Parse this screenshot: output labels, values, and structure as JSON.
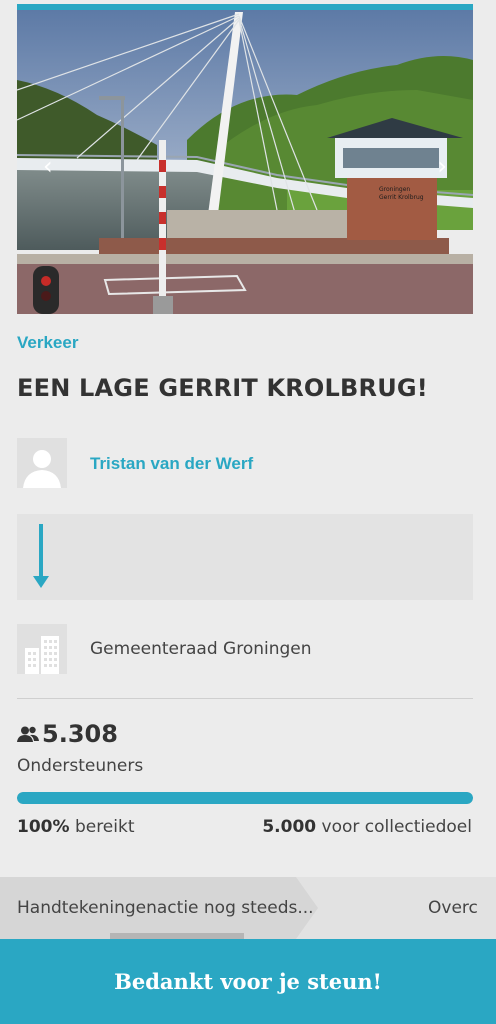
{
  "hero": {
    "prev_icon": "chevron-left-icon",
    "next_icon": "chevron-right-icon",
    "prev_glyph": "‹",
    "next_glyph": "›",
    "sign_line1": "Groningen",
    "sign_line2": "Gerrit Krolbrug"
  },
  "petition": {
    "category": "Verkeer",
    "title": "EEN LAGE GERRIT KROLBRUG!",
    "author": "Tristan van der Werf",
    "recipient": "Gemeenteraad Groningen"
  },
  "stats": {
    "supporters_count": "5.308",
    "supporters_label": "Ondersteuners",
    "progress_percent": 100,
    "reached_value": "100%",
    "reached_label": "bereikt",
    "goal_value": "5.000",
    "goal_label": "voor collectiedoel"
  },
  "status": {
    "step1": "Handtekeningenactie nog steeds...",
    "step2": "Overc"
  },
  "cta": {
    "label": "Bedankt voor je steun!"
  },
  "colors": {
    "accent": "#2aa7c3",
    "background": "#ececec",
    "text": "#333333"
  }
}
